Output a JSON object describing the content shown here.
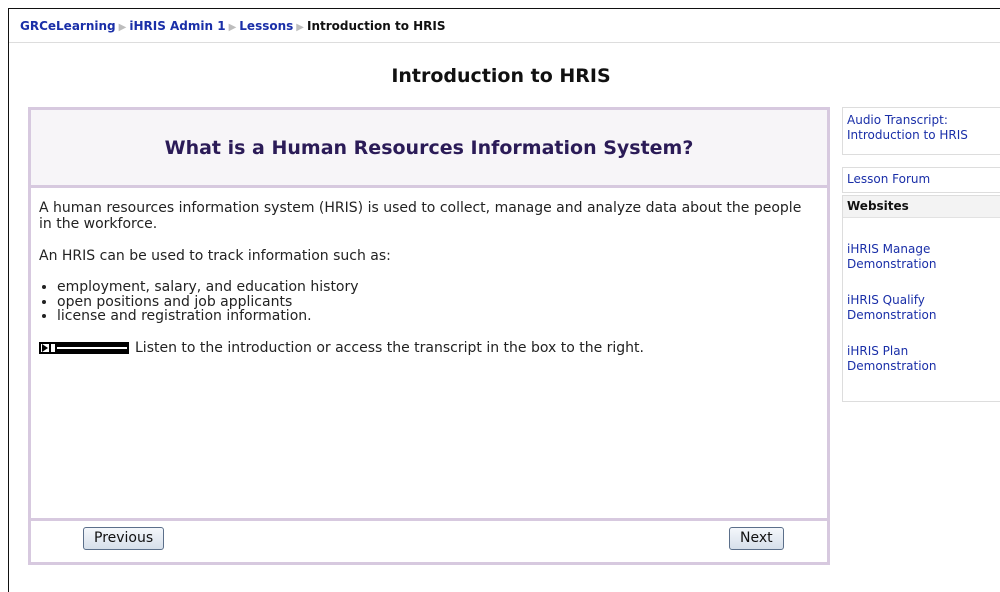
{
  "breadcrumb": {
    "items": [
      "GRCeLearning",
      "iHRIS Admin 1",
      "Lessons"
    ],
    "separator": "▶",
    "current": "Introduction to HRIS"
  },
  "page": {
    "title": "Introduction to HRIS"
  },
  "lesson": {
    "heading": "What is a Human Resources Information System?",
    "paragraph1": "A human resources information system (HRIS) is used to collect, manage and analyze data about the people in the workforce.",
    "paragraph2": "An HRIS can be used to track information such as:",
    "bullets": [
      "employment, salary, and education history",
      "open positions and job applicants",
      "license and registration information."
    ],
    "audio_text": "Listen to the introduction or access the transcript in the box to the right."
  },
  "nav": {
    "previous": "Previous",
    "next": "Next"
  },
  "sidebar": {
    "audio_transcript": "Audio Transcript: Introduction to HRIS",
    "lesson_forum": "Lesson Forum",
    "websites": {
      "title": "Websites",
      "collapse_symbol": "−",
      "links": [
        "iHRIS Manage Demonstration",
        "iHRIS Qualify Demonstration",
        "iHRIS Plan Demonstration"
      ]
    }
  },
  "colors": {
    "link": "#1a2fa8",
    "panel_border": "#d7c9df",
    "heading": "#2b1b57"
  },
  "icons": {
    "breadcrumb_separator": "triangle-right-icon",
    "audio_player": "audio-player-icon",
    "collapse": "collapse-icon"
  }
}
